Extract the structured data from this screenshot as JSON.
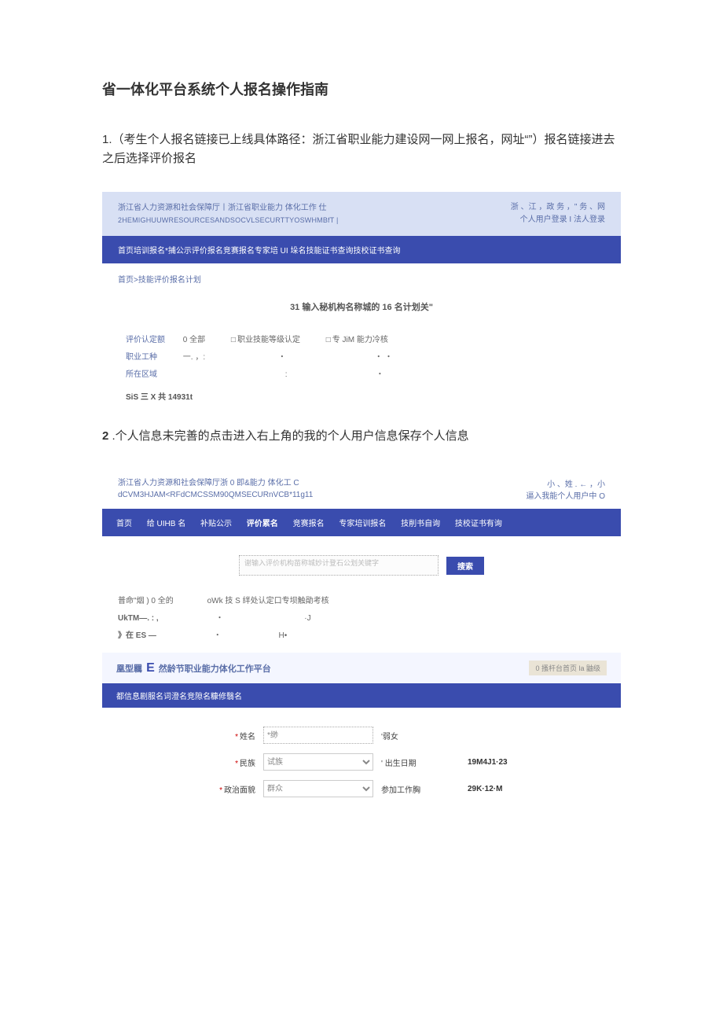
{
  "doc": {
    "title": "省一体化平台系统个人报名操作指南",
    "step1": "1.（考生个人报名链接已上线具体路径：浙江省职业能力建设网一网上报名，网址“”）报名链接进去之后选择评价报名",
    "step2_num": "2",
    "step2_text": " .个人信息未完善的点击进入右上角的我的个人用户信息保存个人信息"
  },
  "shot1": {
    "header_l1": "浙江省人力资源和社会保障厅丨浙江省职业能力 体化工作 仕",
    "header_l2": "2HEMIGHUUWRESOURCESANDSOCVLSECURTTYOSWHMBfT |",
    "header_r1": "浙 、江 ，政 务 ，\" 务 、网",
    "header_r2": "个人用户登录 I 法人登录",
    "nav": "首页培训报名*捕公示评价报名竞赛报名专家培 UI 垛名技能证书查询技校证书查询",
    "crumb": "首页>技能评价报名计划",
    "search_hint": "31 输入秘机构名称城的 16 名计划关\"",
    "filters": {
      "type_label": "评价认定额",
      "type_all": "0 全部",
      "type_opt1": "职业技能等级认定",
      "type_opt2": "专 JiM 能力冷核",
      "job_label": "职业工种",
      "job_v1": "一. ，:",
      "job_v2": "・",
      "job_v3": "・  ・",
      "area_label": "所在区域",
      "area_v1": ":",
      "area_v2": "・"
    },
    "result": "SiS 三 X 共 14931t"
  },
  "shot2": {
    "header_l1": "浙江省人力资源和社会保障厅浙 0 即&能力 体化工 C",
    "header_l2": "dCVM3HJAM<RFdCMCSSM90QMSECURnVCB*11g11",
    "header_r1": "小 、姓 . ← ，小",
    "header_r2": "逼入我能个人用户中 O",
    "nav": [
      "首页",
      "给 UIHB 名",
      "补贴公示",
      "评价累名",
      "竞赛报名",
      "专家培训报名",
      "技削书自询",
      "技校证书有询"
    ],
    "search_placeholder": "谢输入评价机构苗称城妙计登石公划关键字",
    "search_btn": "搜索",
    "fil": {
      "r1_a": "普命\"烟 ) 0 全的",
      "r1_b": "oWk 技 S 绊处认定口专坝触勛考核",
      "r2_a": "UkTM—. :  ,",
      "r2_b": "・",
      "r2_c": "·J",
      "r3_a": "》在 ES    —",
      "r3_b": "・",
      "r3_c": "H•"
    },
    "inner_title_a": "凰型羈",
    "inner_title_big": "E",
    "inner_title_b": "然龄节职业能力体化工作平台",
    "inner_goto": "0 搔杆台首页 la 鼬级",
    "inner_nav": "都信息剧服名词澄名竞隙名糠修翳名",
    "form": {
      "name_label": "姓名",
      "name_value": "*缈",
      "name_side_label": "'弱女",
      "ethnic_label": "民族",
      "ethnic_value": "试族",
      "ethnic_side_label": "' 出生日期",
      "ethnic_side_value": "19M4J1·23",
      "polit_label": "政治面貌",
      "polit_value": "群众",
      "polit_side_label": "参加工作胸",
      "polit_side_value": "29K·12·M"
    }
  }
}
